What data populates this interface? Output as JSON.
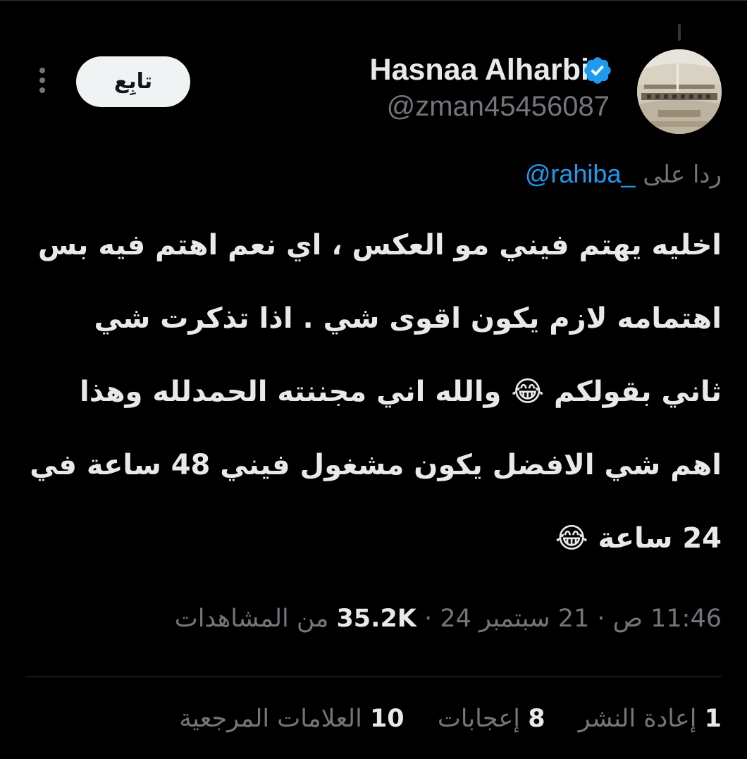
{
  "author": {
    "name": "Hasnaa Alharbi",
    "handle": "@zman45456087"
  },
  "follow_button": {
    "label": "تابِع"
  },
  "reply": {
    "prefix": "ردا على",
    "mention": "@rahiba_"
  },
  "tweet": {
    "text": "اخليه يهتم فيني مو العكس ، اي نعم اهتم فيه بس اهتمامه لازم يكون اقوى شي . اذا تذكرت شي ثاني بقولكم 😂 والله اني مجننته الحمدلله وهذا اهم شي الافضل يكون مشغول فيني 48 ساعة في 24 ساعة 😂"
  },
  "meta": {
    "time": "11:46 ص",
    "date": "21 سبتمبر 24",
    "separator": "·",
    "views_count": "35.2K",
    "views_label": "من المشاهدات"
  },
  "stats": [
    {
      "count": "1",
      "label": "إعادة النشر"
    },
    {
      "count": "8",
      "label": "إعجابات"
    },
    {
      "count": "10",
      "label": "العلامات المرجعية"
    }
  ],
  "colors": {
    "background": "#000000",
    "text_primary": "#e7e9ea",
    "text_secondary": "#71767b",
    "link": "#1d9bf0",
    "verified": "#1d9bf0",
    "divider": "#2f3336"
  },
  "icons": [
    "verified-badge-icon",
    "more-options-icon"
  ]
}
